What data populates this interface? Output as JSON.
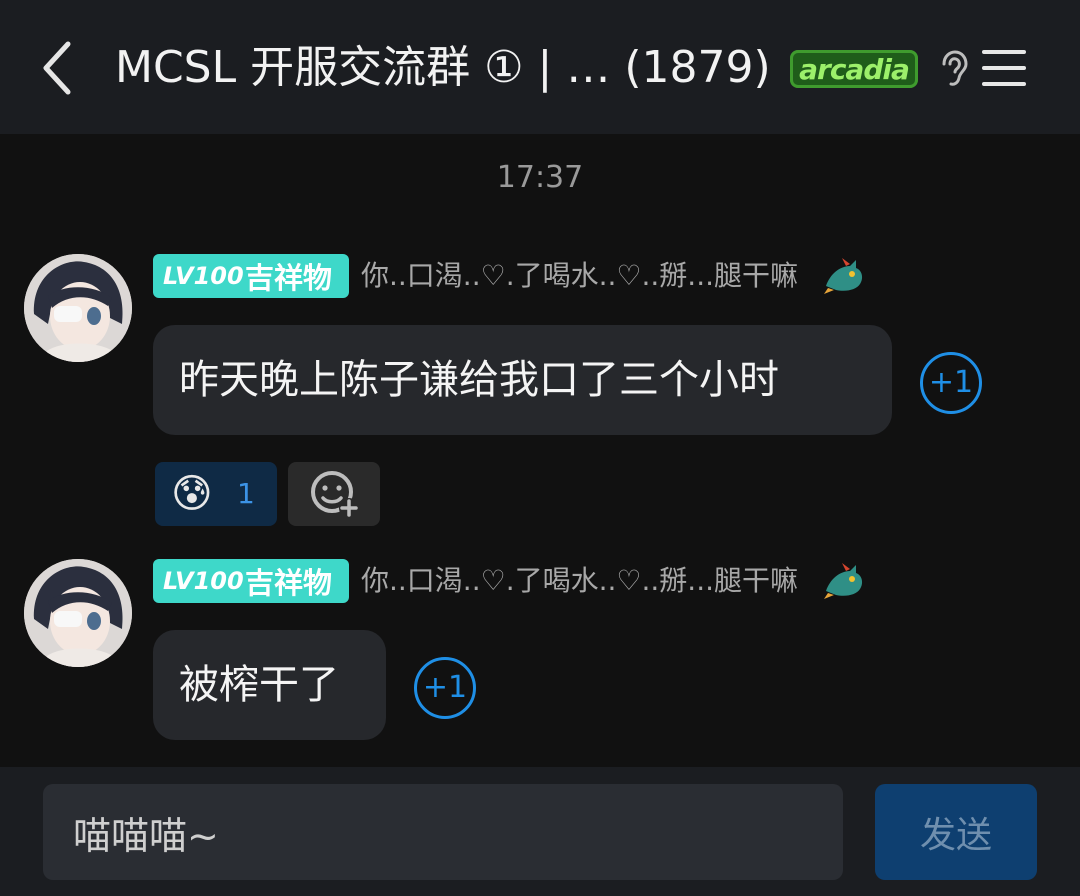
{
  "header": {
    "title": "MCSL 开服交流群 ① | …  (1879)",
    "badge_text": "arcadia",
    "back_icon": "chevron-left-icon",
    "ear_icon": "ear-icon",
    "menu_icon": "hamburger-menu-icon"
  },
  "timestamp": "17:37",
  "messages": [
    {
      "level": "LV100",
      "role": "吉祥物",
      "sender": "你..口渴..♡.了喝水..♡..掰...腿干嘛",
      "text": "昨天晚上陈子谦给我口了三个小时",
      "plus_one": "+1",
      "reaction_emoji": "😰",
      "reaction_count": "1"
    },
    {
      "level": "LV100",
      "role": "吉祥物",
      "sender": "你..口渴..♡.了喝水..♡..掰...腿干嘛",
      "text": "被榨干了",
      "plus_one": "+1"
    }
  ],
  "composer": {
    "value": "喵喵喵~",
    "send_label": "发送"
  },
  "colors": {
    "accent": "#1f8fe6",
    "level_badge": "#3ed8c9",
    "bubble": "#26282c",
    "background": "#111111"
  }
}
